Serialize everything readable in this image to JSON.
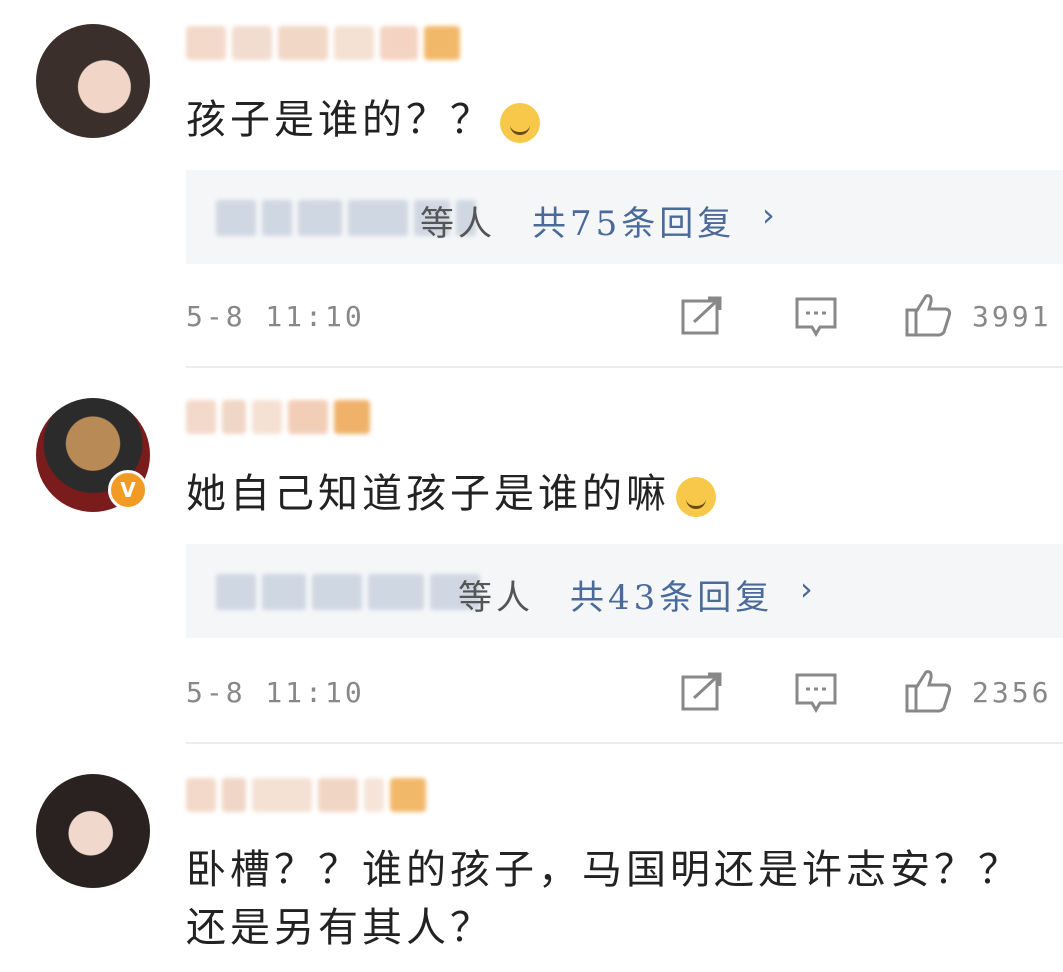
{
  "comments": [
    {
      "text": "孩子是谁的？？",
      "reply_summary_suffix": "等人",
      "reply_count_label": "共75条回复",
      "reply_chevron": "›",
      "time": "5-8 11:10",
      "like_count": "3991",
      "emoji": "doge-emoji"
    },
    {
      "text": "她自己知道孩子是谁的嘛",
      "reply_summary_suffix": "等人",
      "reply_count_label": "共43条回复",
      "reply_chevron": "›",
      "time": "5-8 11:10",
      "like_count": "2356",
      "emoji": "smile-emoji",
      "verified_badge": "V"
    },
    {
      "text_line1": "卧槽？？谁的孩子，马国明还是许志安？？",
      "text_line2": "还是另有其人？"
    }
  ],
  "colors": {
    "link_blue": "#4a6a99",
    "meta_gray": "#888888",
    "reply_bg": "#f5f6f8",
    "badge_orange": "#f19b24"
  },
  "icons": [
    "repost-icon",
    "comment-icon",
    "like-icon"
  ]
}
